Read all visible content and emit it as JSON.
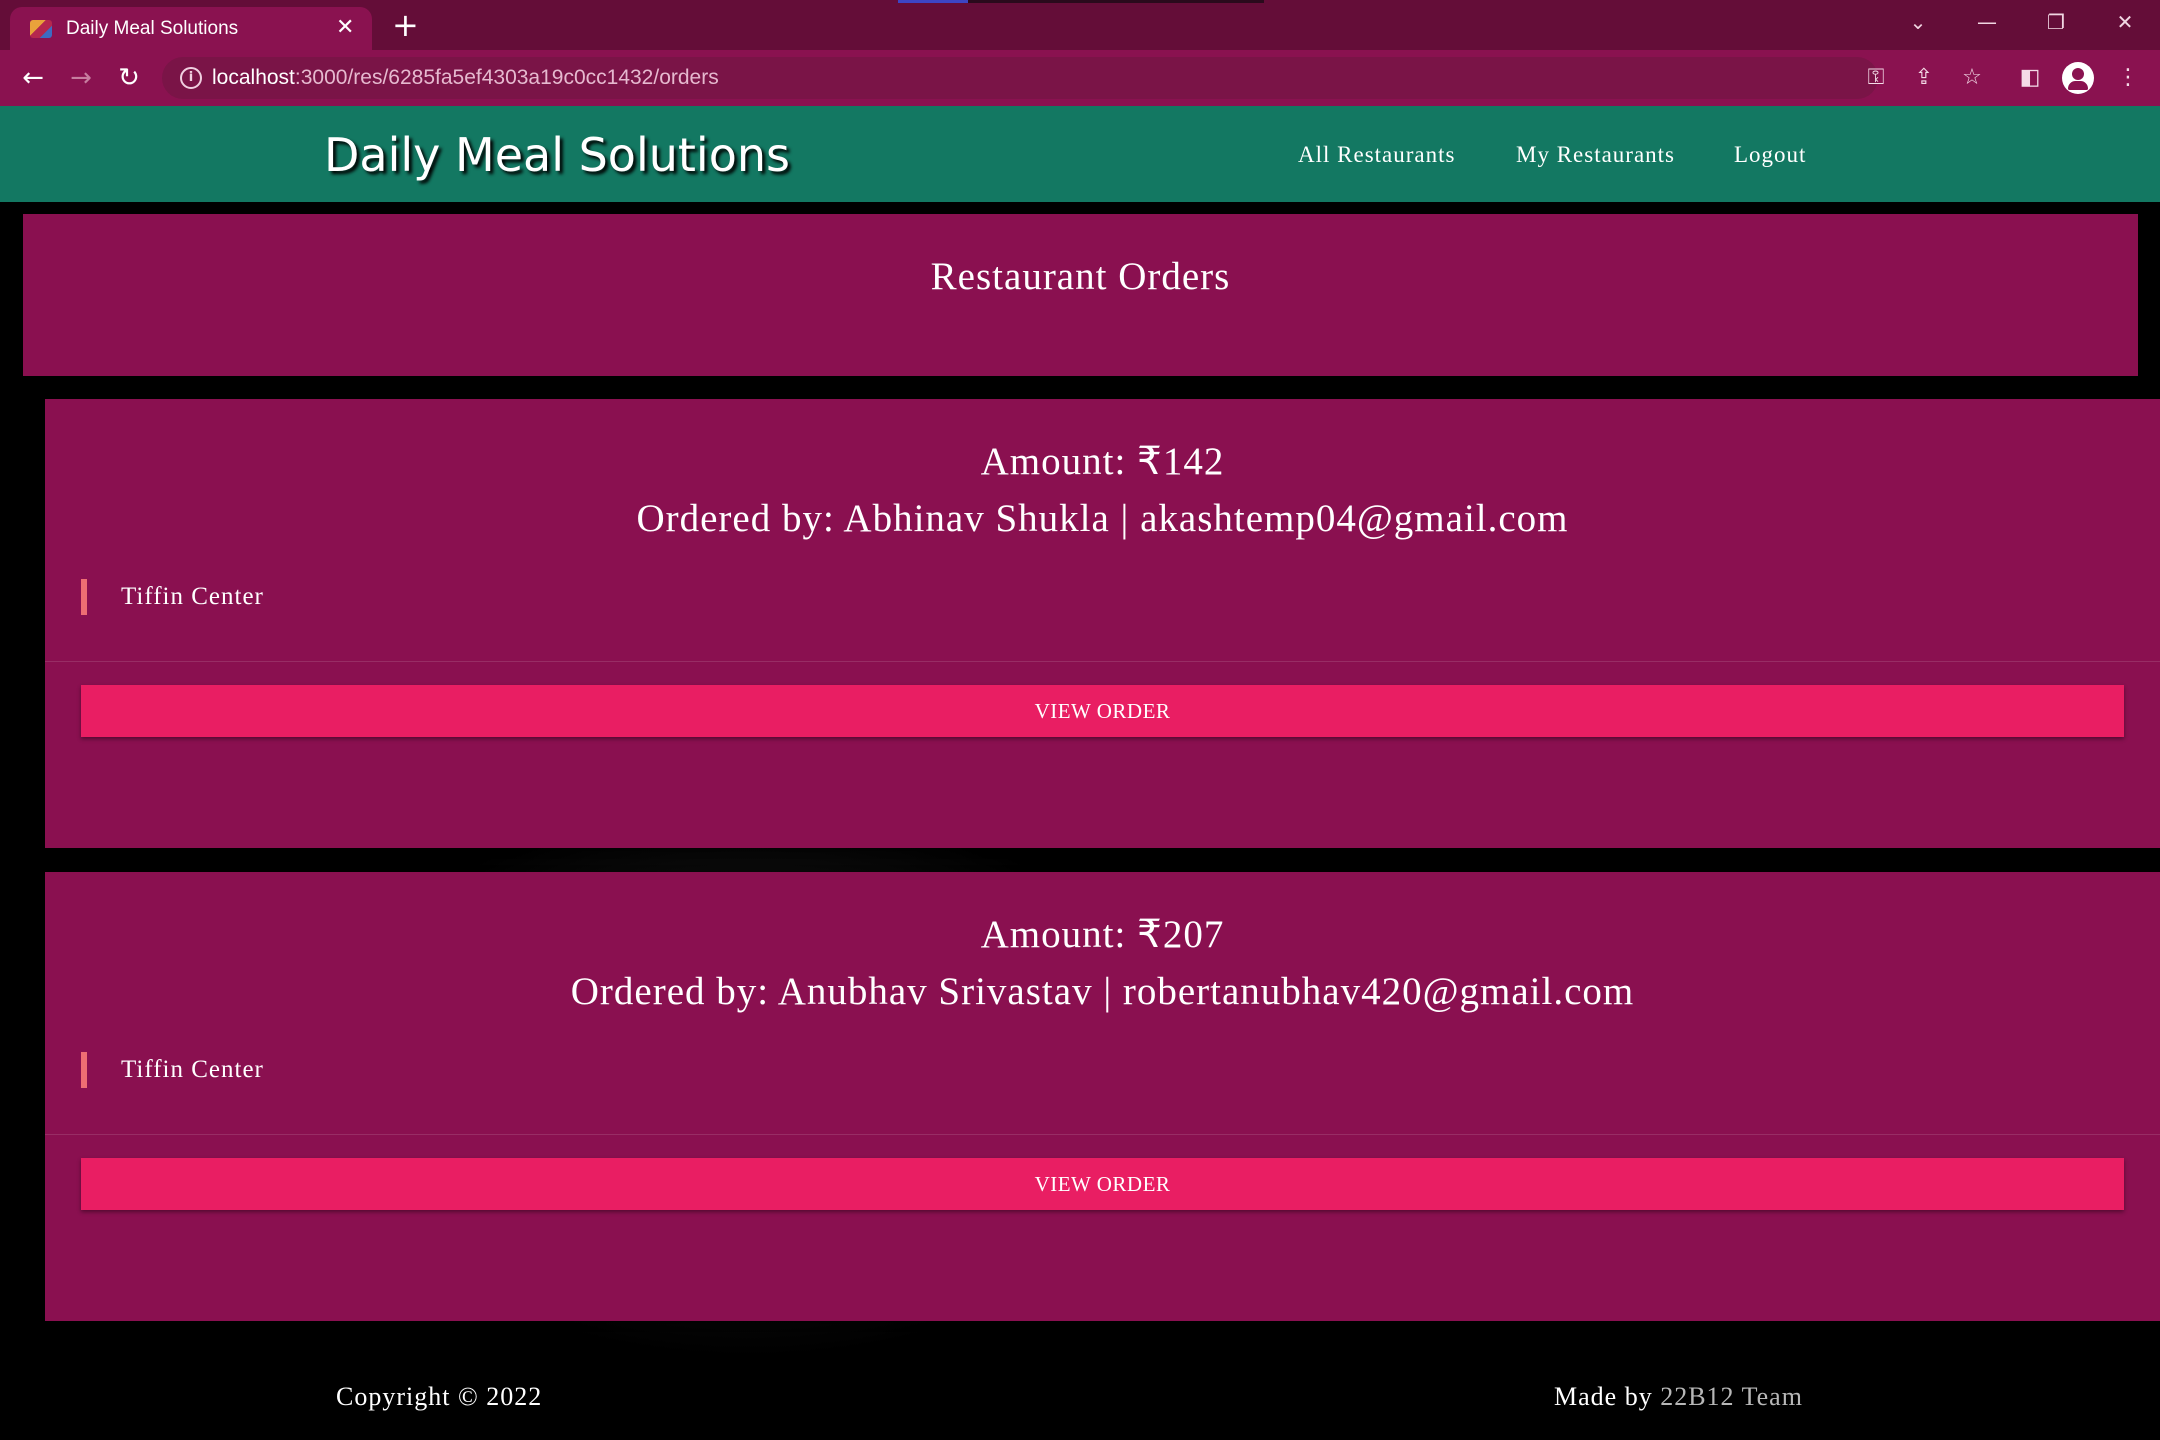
{
  "browser": {
    "tab_title": "Daily Meal Solutions",
    "tab_close_glyph": "✕",
    "new_tab_glyph": "+",
    "url_host": "localhost",
    "url_path": ":3000/res/6285fa5ef4303a19c0cc1432/orders",
    "window_controls": [
      "⌄",
      "—",
      "❐",
      "✕"
    ]
  },
  "navbar": {
    "brand": "Daily Meal Solutions",
    "links": [
      "All Restaurants",
      "My Restaurants",
      "Logout"
    ]
  },
  "header": {
    "title": "Restaurant Orders"
  },
  "orders": [
    {
      "amount": "Amount: ₹142",
      "ordered_by": "Ordered by: Abhinav Shukla | akashtemp04@gmail.com",
      "restaurant": "Tiffin Center",
      "button": "VIEW ORDER"
    },
    {
      "amount": "Amount: ₹207",
      "ordered_by": "Ordered by: Anubhav Srivastav | robertanubhav420@gmail.com",
      "restaurant": "Tiffin Center",
      "button": "VIEW ORDER"
    }
  ],
  "footer": {
    "copyright": "Copyright © 2022",
    "made_by": "Made by",
    "team": "22B12 Team"
  },
  "colors": {
    "navbar": "#137862",
    "card": "#8a1050",
    "button": "#e91e63",
    "restaurant_accent": "#ee6e73",
    "chrome": "#640d38"
  }
}
